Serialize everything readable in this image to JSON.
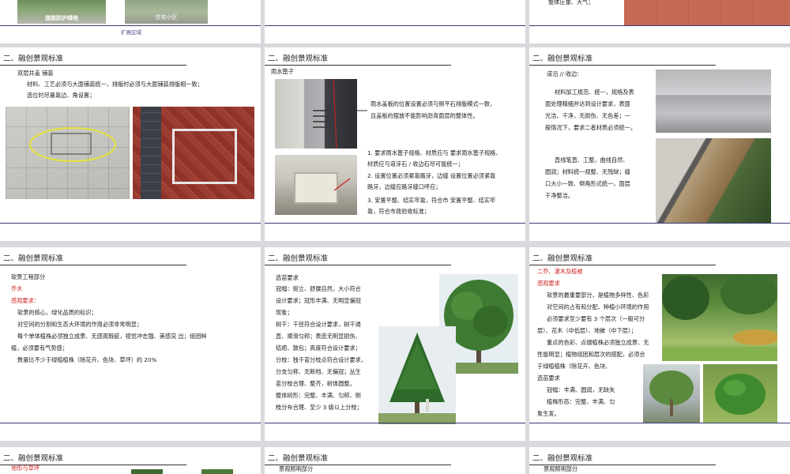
{
  "row0": {
    "s1": {
      "caption_a": "道路防护绿地",
      "caption_b": "住宅小区",
      "footer": "扩展区域"
    },
    "s3": {
      "text": "整体庄重、大气；"
    }
  },
  "slide_title": "二、融创景观标准",
  "s4": {
    "heading": "双层井盖 铺装",
    "lines": [
      "材料、工艺必须与大面铺装统一，排版时必须与大面铺装排版相一致；",
      "选位时尽量靠边、角设置；"
    ]
  },
  "s5": {
    "heading": "雨水篦子",
    "desc": [
      "雨水盖板的位置设置必须与侧平石排版模式一致，",
      "且盖板的摆放不能影响沥青面层的整体性。"
    ],
    "points": [
      "1. 要求雨水篦子规格、材质应与 要求雨水篦子规格、",
      "材质应与道牙石 / 收边石尽可能统一；",
      "2. 设置位置必须紧靠路牙，边缝 设置位置必须紧靠",
      "路牙，边缝应路牙缝口呼应；",
      "3. 安置平整、结实牢靠，符合市 安置平整、结实牢",
      "靠，符合市政验收标准；"
    ]
  },
  "s6": {
    "heading": "道沿 // 收边：",
    "p1": [
      "材料加工规范、统一，规格及表",
      "面处理精细并达到设计要求，表面",
      "光洁、干净，无损伤、无色差；一",
      "般情况下，要求二者材质必须统一。"
    ],
    "p2": [
      "直线笔直、工整，曲线自然、",
      "圆润；材料统一规整、无残缺；缝",
      "口大小一致、倒角形式统一，面层",
      "干净整洁。"
    ]
  },
  "s7": {
    "heading": "软景工程部分",
    "sub1": "乔木",
    "sub2": "感观要求：",
    "lines": [
      "软景的核心，绿化品质的标识；",
      "对空间的分割和生态大环境的作用必须非常明显；",
      "每个单体植株必须独立成景、无感观瑕疵，视觉冲击强、美感突 出；组团种",
      "植，必须要有气势感；",
      "数量比不少于绿植植株（除花卉、色块、草坪）的 20%"
    ]
  },
  "s8": {
    "lines": [
      "选苗要求",
      "冠幅：挺立、舒展自然，大小符合",
      "设计要求；冠形丰满、无明显偏冠",
      "现象；",
      "树干：干径符合设计要求，树干通",
      "直、顺滑匀称；表皮无明显损伤、",
      "结疤、鼓包；高度符合设计要求；",
      "分枝：独干苗分枝点符合设计要求，",
      "分支匀称、无断档、无偏冠；丛生",
      "苗分枝合理、整齐，树体圆整。",
      "整体树形：完整、丰满、匀称、侧",
      "枝分布合理、至少 3 级以上分枝；"
    ]
  },
  "s9": {
    "sub1": "二乔、灌木及植被",
    "sub2": "感观要求",
    "lines": [
      "软景的最重要部分，是植物多样性、色彩",
      "对空间的占有和分配、种植小环境的作用",
      "必须要求至少要有 3 个层次（一般可分",
      "层）、花木（中低层）、地被（中下层）；",
      "重点的色彩、点缀植株必须独立成景、无",
      "性能明显；植物组团和层次的搭配，必须合",
      "于绿植植株（除花卉、色块、",
      "选苗要求",
      "冠幅：丰满、圆润，无缺失",
      "植株形态：完整、丰满、匀",
      "象生发。"
    ]
  },
  "s10": {
    "sub1": "地形与草坪"
  },
  "s11": {
    "heading": "景观照明部分"
  },
  "s12": {
    "heading": "景观照明部分"
  }
}
